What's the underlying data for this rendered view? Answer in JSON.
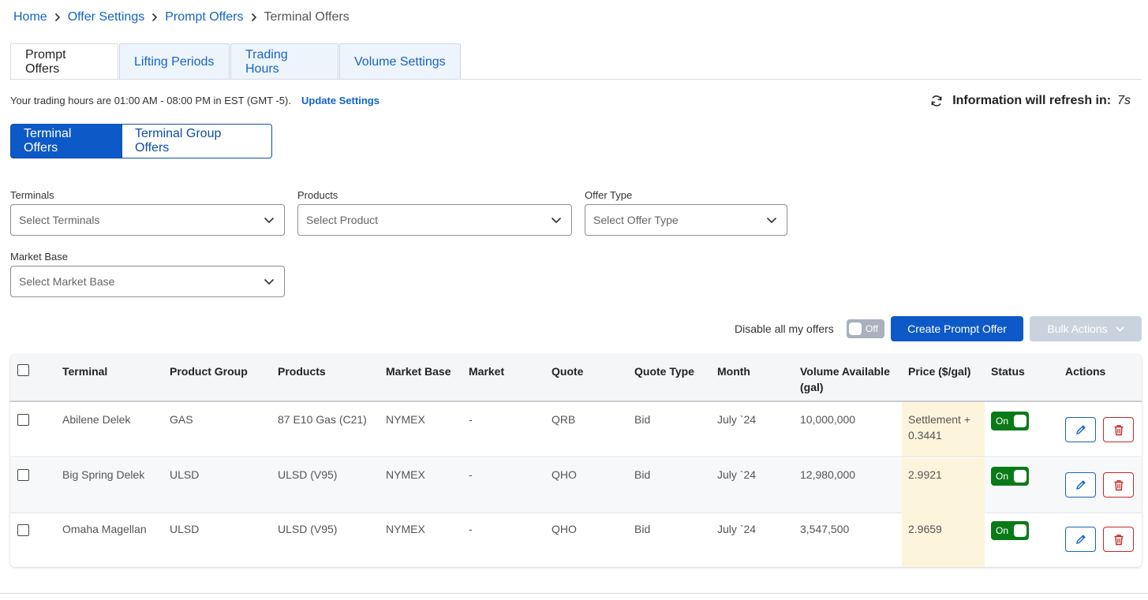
{
  "breadcrumb": {
    "items": [
      "Home",
      "Offer Settings",
      "Prompt Offers"
    ],
    "current": "Terminal Offers"
  },
  "tabs": [
    "Prompt Offers",
    "Lifting Periods",
    "Trading Hours",
    "Volume Settings"
  ],
  "trading": {
    "text": "Your trading hours are 01:00 AM - 08:00 PM in EST (GMT -5).",
    "update_label": "Update Settings"
  },
  "refresh": {
    "label": "Information will refresh in:",
    "seconds": "7s"
  },
  "segment": {
    "terminal": "Terminal Offers",
    "group": "Terminal Group Offers"
  },
  "filters": {
    "terminals": {
      "label": "Terminals",
      "placeholder": "Select Terminals"
    },
    "products": {
      "label": "Products",
      "placeholder": "Select Product"
    },
    "offer_type": {
      "label": "Offer Type",
      "placeholder": "Select Offer Type"
    },
    "market_base": {
      "label": "Market Base",
      "placeholder": "Select Market Base"
    }
  },
  "toolbar": {
    "disable_label": "Disable all my offers",
    "toggle_text": "Off",
    "create_label": "Create Prompt Offer",
    "bulk_label": "Bulk Actions"
  },
  "table": {
    "headers": {
      "terminal": "Terminal",
      "product_group": "Product Group",
      "products": "Products",
      "market_base": "Market Base",
      "market": "Market",
      "quote": "Quote",
      "quote_type": "Quote Type",
      "month": "Month",
      "volume_1": "Volume Available",
      "volume_2": "(gal)",
      "price": "Price ($/gal)",
      "status": "Status",
      "actions": "Actions"
    },
    "rows": [
      {
        "terminal": "Abilene Delek",
        "product_group": "GAS",
        "products": "87 E10 Gas (C21)",
        "market_base": "NYMEX",
        "market": "-",
        "quote": "QRB",
        "quote_type": "Bid",
        "month": "July `24",
        "volume": "10,000,000",
        "price_1": "Settlement +",
        "price_2": "0.3441",
        "status": "On"
      },
      {
        "terminal": "Big Spring Delek",
        "product_group": "ULSD",
        "products": "ULSD (V95)",
        "market_base": "NYMEX",
        "market": "-",
        "quote": "QHO",
        "quote_type": "Bid",
        "month": "July `24",
        "volume": "12,980,000",
        "price_1": "2.9921",
        "price_2": "",
        "status": "On"
      },
      {
        "terminal": "Omaha Magellan",
        "product_group": "ULSD",
        "products": "ULSD (V95)",
        "market_base": "NYMEX",
        "market": "-",
        "quote": "QHO",
        "quote_type": "Bid",
        "month": "July `24",
        "volume": "3,547,500",
        "price_1": "2.9659",
        "price_2": "",
        "status": "On"
      }
    ]
  },
  "colors": {
    "primary": "#0d59c7",
    "link": "#1565c0",
    "status_on": "#0a7a19",
    "delete": "#c62828",
    "price_highlight": "#fdf4dc"
  }
}
